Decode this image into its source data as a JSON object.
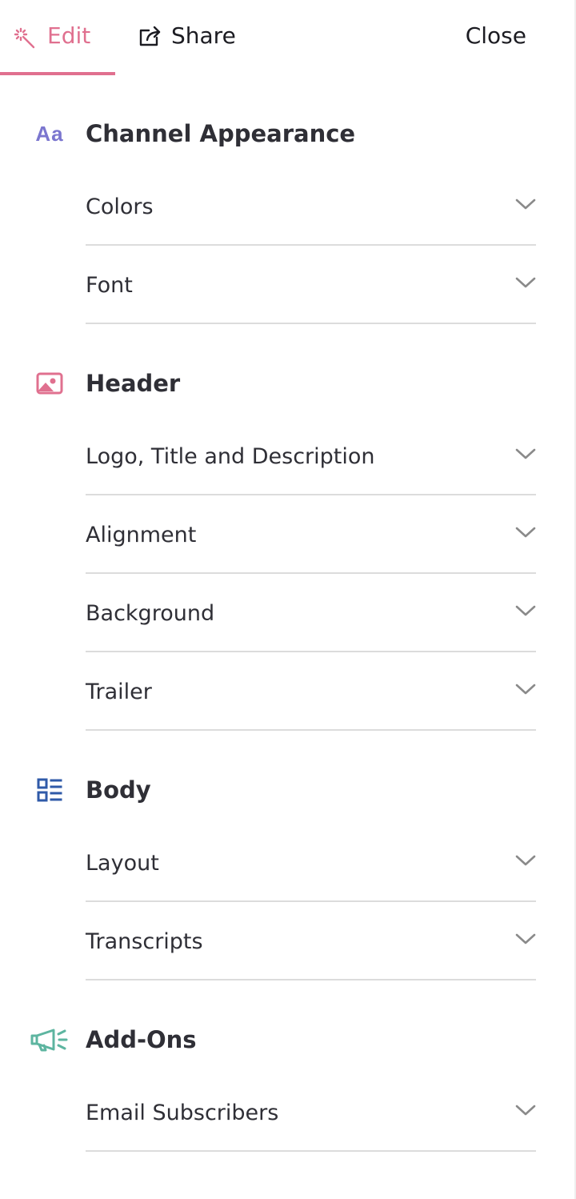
{
  "tabs": {
    "edit": {
      "label": "Edit",
      "icon": "magic-wand-icon",
      "active": true
    },
    "share": {
      "label": "Share",
      "icon": "share-icon"
    }
  },
  "close_label": "Close",
  "colors": {
    "accent": "#e0708f",
    "appearance_icon": "#7b76cf",
    "header_icon": "#e0708f",
    "body_icon": "#2f5aa8",
    "addons_icon": "#5db5a0",
    "divider": "#dcdcdc"
  },
  "sections": {
    "appearance": {
      "icon_text": "Aa",
      "icon": "text-style-icon",
      "title": "Channel Appearance",
      "items": [
        {
          "label": "Colors"
        },
        {
          "label": "Font"
        }
      ]
    },
    "header": {
      "icon": "image-icon",
      "title": "Header",
      "items": [
        {
          "label": "Logo, Title and Description"
        },
        {
          "label": "Alignment"
        },
        {
          "label": "Background"
        },
        {
          "label": "Trailer"
        }
      ]
    },
    "body": {
      "icon": "list-layout-icon",
      "title": "Body",
      "items": [
        {
          "label": "Layout"
        },
        {
          "label": "Transcripts"
        }
      ]
    },
    "addons": {
      "icon": "megaphone-icon",
      "title": "Add-Ons",
      "items": [
        {
          "label": "Email Subscribers"
        }
      ]
    }
  }
}
